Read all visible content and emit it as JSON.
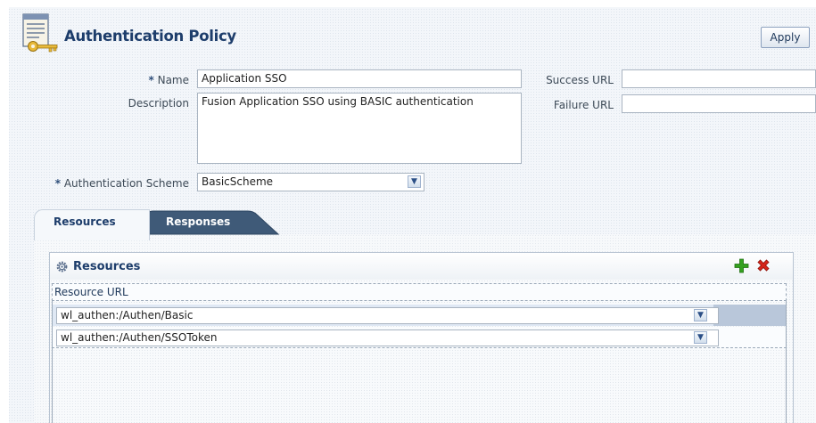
{
  "header": {
    "title": "Authentication Policy",
    "apply_label": "Apply"
  },
  "form": {
    "name_label": "Name",
    "name_value": "Application SSO",
    "description_label": "Description",
    "description_value": "Fusion Application SSO using BASIC authentication",
    "scheme_label": "Authentication Scheme",
    "scheme_value": "BasicScheme",
    "success_url_label": "Success URL",
    "success_url_value": "",
    "failure_url_label": "Failure URL",
    "failure_url_value": "",
    "required_marker": "*"
  },
  "tabs": [
    {
      "label": "Resources",
      "active": true
    },
    {
      "label": "Responses",
      "active": false
    }
  ],
  "resources": {
    "title": "Resources",
    "column_header": "Resource URL",
    "rows": [
      {
        "value": "wl_authen:/Authen/Basic"
      },
      {
        "value": "wl_authen:/Authen/SSOToken"
      }
    ]
  },
  "colors": {
    "title": "#1d3d6b",
    "add_icon": "#34a11f",
    "delete_icon": "#d6251a",
    "inactive_tab": "#3f5a78"
  }
}
